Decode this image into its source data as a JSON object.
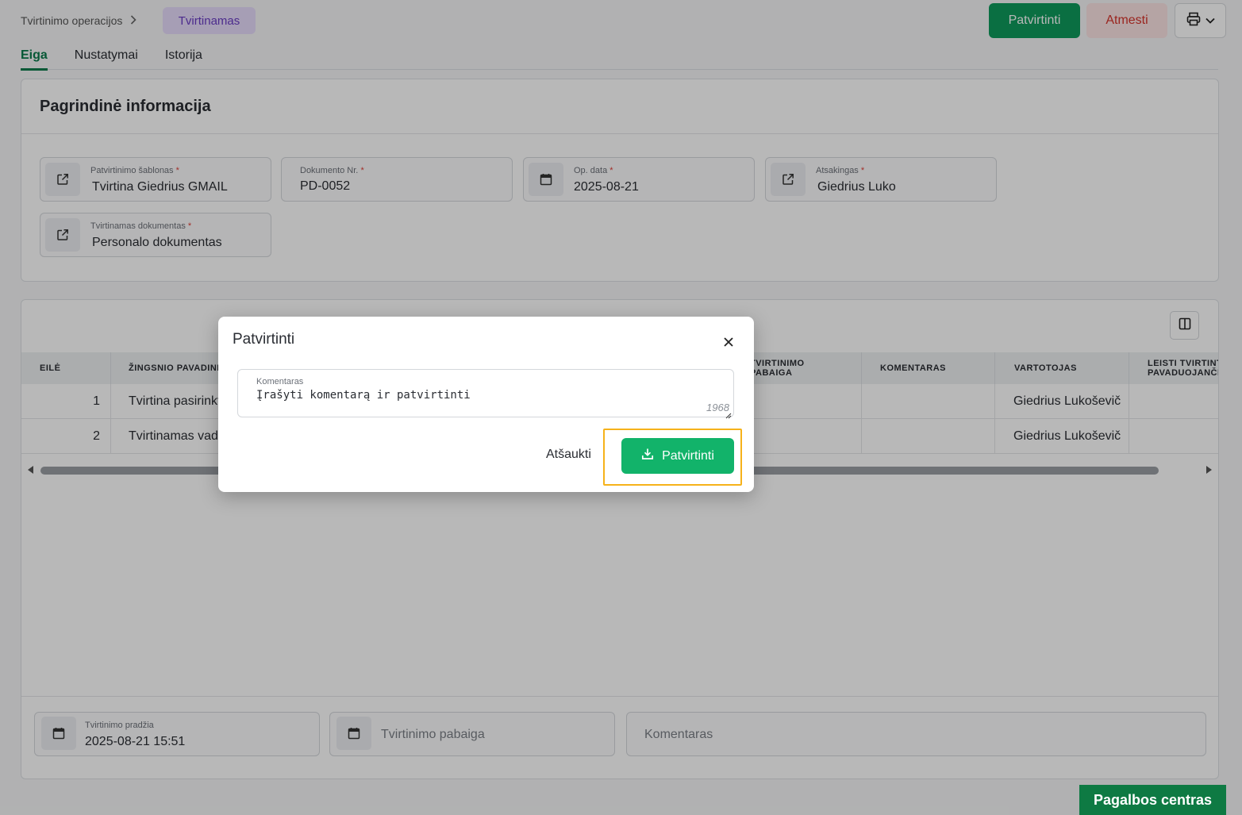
{
  "header": {
    "breadcrumb": "Tvirtinimo operacijos",
    "status_badge": "Tvirtinamas",
    "approve_label": "Patvirtinti",
    "reject_label": "Atmesti",
    "print_icon": "printer-icon"
  },
  "tabs": [
    {
      "label": "Eiga",
      "active": true
    },
    {
      "label": "Nustatymai",
      "active": false
    },
    {
      "label": "Istorija",
      "active": false
    }
  ],
  "info": {
    "title": "Pagrindinė informacija",
    "fields": [
      {
        "label": "Patvirtinimo šablonas",
        "required": "*",
        "value": "Tvirtina Giedrius GMAIL",
        "icon": "external-link-icon"
      },
      {
        "label": "Dokumento Nr.",
        "required": "*",
        "value": "PD-0052"
      },
      {
        "label": "Op. data",
        "required": "*",
        "value": "2025-08-21",
        "icon": "calendar-icon"
      },
      {
        "label": "Atsakingas",
        "required": "*",
        "value": "Giedrius Luko",
        "icon": "external-link-icon"
      },
      {
        "label": "Tvirtinamas dokumentas",
        "required": "*",
        "value": "Personalo dokumentas",
        "icon": "external-link-icon"
      }
    ]
  },
  "table": {
    "columns": [
      "EILĖ",
      "ŽINGSNIO PAVADINIMAS",
      "TVIRTINIMO PABAIGA",
      "KOMENTARAS",
      "VARTOTOJAS",
      "LEISTI TVIRTINTI PAVADUOJANČIAM"
    ],
    "rows": [
      {
        "eile": "1",
        "zingsnis": "Tvirtina pasirinktas",
        "pabaiga": "",
        "komentaras": "",
        "vartotojas": "Giedrius Lukoševič",
        "leisti": ""
      },
      {
        "eile": "2",
        "zingsnis": "Tvirtinamas vadovo",
        "pabaiga": "",
        "komentaras": "",
        "vartotojas": "Giedrius Lukoševič",
        "leisti": ""
      }
    ]
  },
  "footer_fields": {
    "start": {
      "label": "Tvirtinimo pradžia",
      "value": "2025-08-21 15:51"
    },
    "end": {
      "placeholder": "Tvirtinimo pabaiga"
    },
    "comment": {
      "placeholder": "Komentaras"
    }
  },
  "modal": {
    "title": "Patvirtinti",
    "comment_label": "Komentaras",
    "comment_value": "Įrašyti komentarą ir patvirtinti",
    "char_count": "1968",
    "cancel_label": "Atšaukti",
    "confirm_label": "Patvirtinti"
  },
  "help_center": "Pagalbos centras",
  "colors": {
    "primary": "#0e9a5c",
    "confirm": "#12b36a",
    "reject_text": "#d6342c",
    "badge_bg": "#e6dcfb",
    "highlight": "#f6b21a"
  }
}
